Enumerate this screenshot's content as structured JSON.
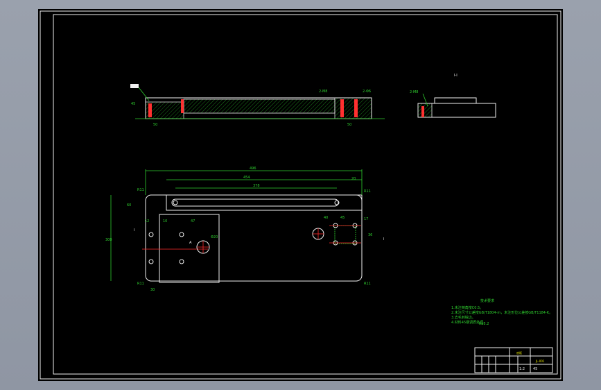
{
  "drawing": {
    "section_label": "I-I",
    "notes_title": "技术要求",
    "notes": [
      "1.未注倒角按C0.5。",
      "2.未注尺寸公差按GB/T1804-m，未注形位公差按GB/T1184-K。",
      "3.去毛刺锐边。",
      "4.材料45钢调质处理。"
    ],
    "roughness_label": "Ra3.2",
    "dimensions": {
      "overall_length": "496",
      "inner_length": "454",
      "slot_length": "378",
      "edge_offset": "20",
      "height_left": "300",
      "dim_60": "60",
      "dim_40": "40",
      "dim_45": "45",
      "dim_17": "17",
      "dim_36": "36",
      "dim_12": "12",
      "dim_10": "10",
      "dim_30": "30",
      "dim_47": "47",
      "radius_top_left": "R11",
      "radius_top_right": "R11",
      "radius_bottom_left": "R11",
      "radius_bottom_right": "R11",
      "hole_big": "Φ20",
      "thread_label_1": "2-M8",
      "thread_label_2": "2-Φ6",
      "section_marker_left": "I",
      "section_marker_right": "I",
      "callout_a": "A",
      "side_left_w": "50",
      "side_right_w": "50",
      "side_h": "45"
    },
    "title_block": {
      "part_name": "底板",
      "drawing_no": "JL-001",
      "scale": "1:2",
      "material": "45"
    }
  }
}
